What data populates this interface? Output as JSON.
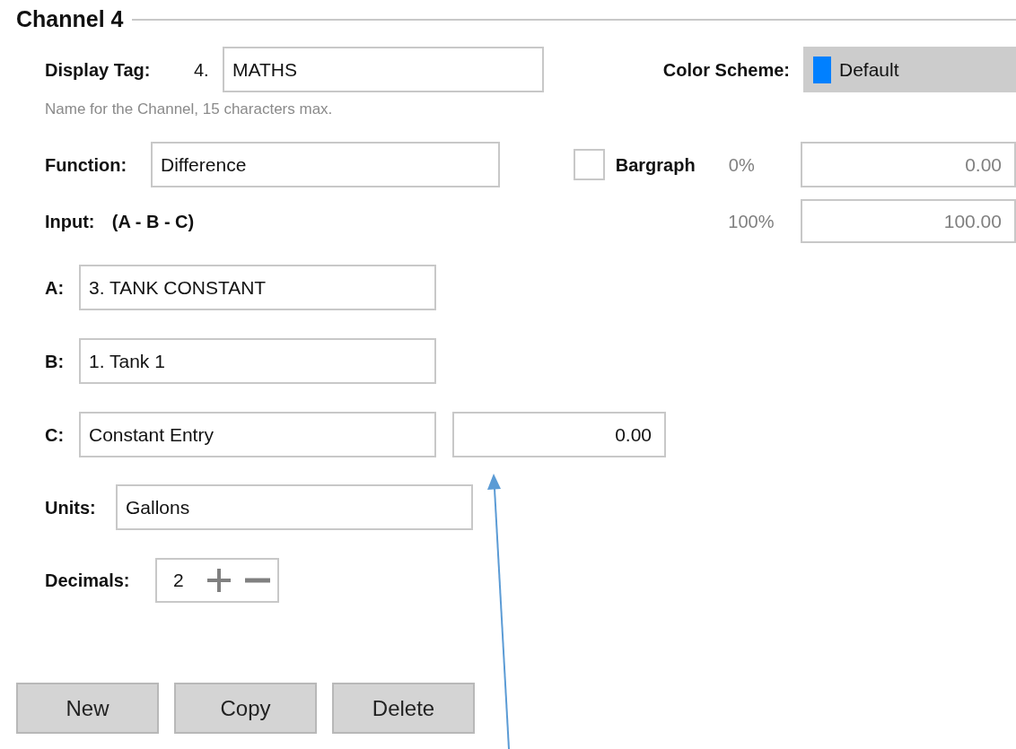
{
  "section": {
    "title": "Channel 4"
  },
  "display_tag": {
    "label": "Display Tag:",
    "prefix": "4.",
    "value": "MATHS",
    "hint": "Name for the Channel, 15 characters max."
  },
  "color_scheme": {
    "label": "Color Scheme:",
    "value": "Default",
    "color": "#0080ff"
  },
  "function": {
    "label": "Function:",
    "value": "Difference"
  },
  "bargraph": {
    "label": "Bargraph",
    "checked": false,
    "min_label": "0%",
    "min_value": "0.00",
    "max_label": "100%",
    "max_value": "100.00"
  },
  "input": {
    "label": "Input:",
    "formula": "(A - B - C)"
  },
  "inputs": [
    {
      "label": "A:",
      "value": "3. TANK CONSTANT"
    },
    {
      "label": "B:",
      "value": "1. Tank 1"
    },
    {
      "label": "C:",
      "value": "Constant Entry",
      "constant": "0.00"
    }
  ],
  "units": {
    "label": "Units:",
    "value": "Gallons"
  },
  "decimals": {
    "label": "Decimals:",
    "value": "2"
  },
  "buttons": [
    "New",
    "Copy",
    "Delete"
  ]
}
